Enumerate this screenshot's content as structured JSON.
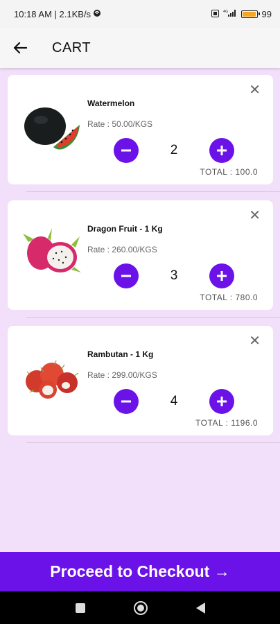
{
  "status_bar": {
    "time_speed": "10:18 AM | 2.1KB/s",
    "battery_pct": "99",
    "battery_fill": 0.99
  },
  "app_bar": {
    "title": "CART",
    "back_icon": "arrow-left-icon"
  },
  "cart": {
    "items": [
      {
        "name": "Watermelon",
        "rate": "Rate : 50.00/KGS",
        "qty": "2",
        "total": "TOTAL : 100.0",
        "image": "watermelon"
      },
      {
        "name": "Dragon Fruit - 1 Kg",
        "rate": "Rate : 260.00/KGS",
        "qty": "3",
        "total": "TOTAL : 780.0",
        "image": "dragon-fruit"
      },
      {
        "name": "Rambutan - 1 Kg",
        "rate": "Rate : 299.00/KGS",
        "qty": "4",
        "total": "TOTAL : 1196.0",
        "image": "rambutan"
      }
    ]
  },
  "checkout": {
    "label": "Proceed to Checkout →"
  },
  "colors": {
    "accent": "#6a12e8",
    "background": "#f2dffa"
  }
}
